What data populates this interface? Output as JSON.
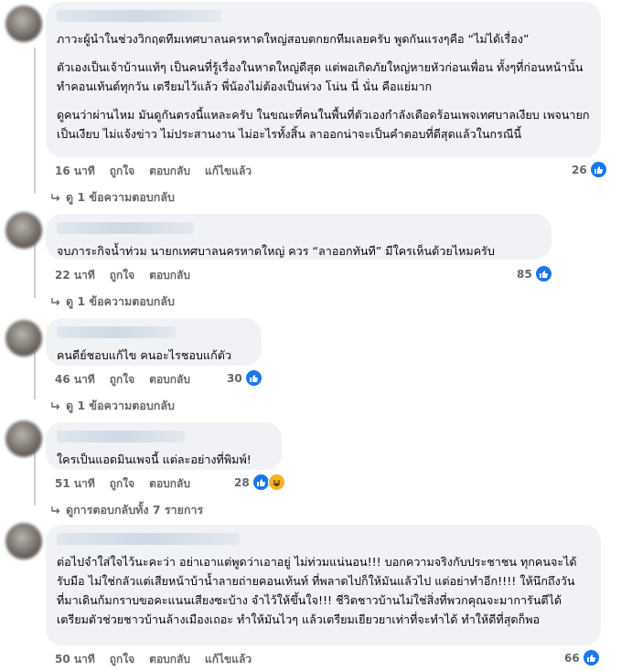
{
  "comments": [
    {
      "paragraphs": [
        "ภาวะผู้นำในช่วงวิกฤตทีมเทศบาลนครหาดใหญ่สอบตกยกทีมเลยครับ พูดกันแรงๆคือ “ไม่ได้เรื่อง”",
        "ตัวเองเป็นเจ้าบ้านแท้ๆ เป็นคนที่รู้เรื่องในหาดใหญ่ดีสุด แต่พอเกิดภัยใหญ่หายหัวก่อนเพื่อน ทั้งๆที่ก่อนหน้านั้นทำคอนเท้นต์ทุกวัน เตรียมไว้แล้ว พี่น้องไม่ต้องเป็นห่วง โน่น นี่ นั่น คือแย่มาก",
        "ดูคนว่าผ่านไหม มันดูกันตรงนี้แหละครับ ในขณะที่คนในพื้นที่ตัวเองกำลังเดือดร้อนเพจเทศบาลเงียบ เพจนายกเป็นเงียบ ไม่แจ้งข่าว ไม่ประสานงาน ไม่อะไรทั้งสิ้น ลาออกน่าจะเป็นคำตอบที่ดีสุดแล้วในกรณีนี้"
      ],
      "time": "16 นาที",
      "like": "ถูกใจ",
      "reply": "ตอบกลับ",
      "edited": "แก้ไขแล้ว",
      "reactions": "26",
      "replies_text": "ดู 1 ข้อความตอบกลับ"
    },
    {
      "paragraphs": [
        "จบภาระกิจน้ำท่วม นายกเทศบาลนครหาดใหญ่ ควร “ลาออกทันที” มีใครเห็นด้วยไหมครับ"
      ],
      "time": "22 นาที",
      "like": "ถูกใจ",
      "reply": "ตอบกลับ",
      "reactions": "85",
      "replies_text": "ดู 1 ข้อความตอบกลับ"
    },
    {
      "paragraphs": [
        "คนดีย์ชอบแก้ไข คนอะไรชอบแก้ตัว"
      ],
      "time": "46 นาที",
      "like": "ถูกใจ",
      "reply": "ตอบกลับ",
      "reactions": "30",
      "replies_text": "ดู 1 ข้อความตอบกลับ"
    },
    {
      "paragraphs": [
        "ใครเป็นแอดมินเพจนี้ แต่ละอย่างที่พิมพ์!"
      ],
      "time": "51 นาที",
      "like": "ถูกใจ",
      "reply": "ตอบกลับ",
      "reactions": "28",
      "replies_text": "ดูการตอบกลับทั้ง 7 รายการ"
    },
    {
      "paragraphs": [
        "ต่อไปจำใส่ใจไว้นะคะว่า อย่าเอาแต่พูดว่าเอาอยู่ ไม่ท่วมแน่นอน!!! บอกความจริงกับประชาชน ทุกคนจะได้รับมือ ไม่ใช่กลัวแต่เสียหน้าบ้าน้ำลายถ่ายคอนเท้นท์ ที่พลาดไปก็ให้มันแล้วไป แต่อย่าทำอีก!!!! ให้นึกถึงวันที่มาเดินก้มกราบขอคะแนนเสียงซะบ้าง จำไว้ให้ขึ้นใจ!!! ชีวิตชาวบ้านไม่ใช่สิ่งที่พวกคุณจะมาการันตีได้ เตรียมตัวช่วยชาวบ้านล้างเมืองเถอะ ทำให้มันไวๆ แล้วเตรียมเยียวยาเท่าที่จะทำได้ ทำให้ดีที่สุดก็พอ"
      ],
      "time": "50 นาที",
      "like": "ถูกใจ",
      "reply": "ตอบกลับ",
      "edited": "แก้ไขแล้ว",
      "reactions": "66"
    }
  ],
  "colors": {
    "like_blue": "#1877f2",
    "bubble_bg": "#f0f2f5",
    "meta_gray": "#65676b"
  }
}
